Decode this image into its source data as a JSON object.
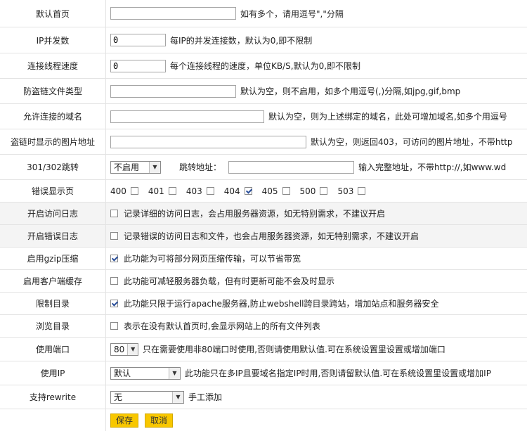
{
  "rows": {
    "default_page": {
      "label": "默认首页",
      "value": "",
      "hint": "如有多个，请用逗号\",\"分隔"
    },
    "ip_concurrency": {
      "label": "IP并发数",
      "value": "0",
      "hint": "每IP的并发连接数，默认为0,即不限制"
    },
    "thread_speed": {
      "label": "连接线程速度",
      "value": "0",
      "hint": "每个连接线程的速度，单位KB/S,默认为0,即不限制"
    },
    "hotlink_types": {
      "label": "防盗链文件类型",
      "value": "",
      "hint": "默认为空，则不启用，如多个用逗号(,)分隔,如jpg,gif,bmp"
    },
    "allowed_domains": {
      "label": "允许连接的域名",
      "value": "",
      "hint": "默认为空，则为上述绑定的域名，此处可增加域名,如多个用逗号"
    },
    "hotlink_image": {
      "label": "盗链时显示的图片地址",
      "value": "",
      "hint": "默认为空，则返回403，可访问的图片地址，不带http"
    },
    "redirect": {
      "label": "301/302跳转",
      "select_value": "不启用",
      "addr_label": "跳转地址：",
      "value": "",
      "hint": "输入完整地址，不带http://,如www.wd"
    },
    "error_pages": {
      "label": "错误显示页",
      "codes": [
        {
          "code": "400",
          "checked": false
        },
        {
          "code": "401",
          "checked": false
        },
        {
          "code": "403",
          "checked": false
        },
        {
          "code": "404",
          "checked": true
        },
        {
          "code": "405",
          "checked": false
        },
        {
          "code": "500",
          "checked": false
        },
        {
          "code": "503",
          "checked": false
        }
      ]
    },
    "access_log": {
      "label": "开启访问日志",
      "checked": false,
      "desc": "记录详细的访问日志，会占用服务器资源，如无特别需求，不建议开启"
    },
    "error_log": {
      "label": "开启错误日志",
      "checked": false,
      "desc": "记录错误的访问日志和文件，也会占用服务器资源，如无特别需求，不建议开启"
    },
    "gzip": {
      "label": "启用gzip压缩",
      "checked": true,
      "desc": "此功能为可将部分网页压缩传输，可以节省带宽"
    },
    "client_cache": {
      "label": "启用客户端缓存",
      "checked": false,
      "desc": "此功能可减轻服务器负载，但有时更新可能不会及时显示"
    },
    "restrict_dir": {
      "label": "限制目录",
      "checked": true,
      "desc": "此功能只限于运行apache服务器,防止webshell跨目录跨站，增加站点和服务器安全"
    },
    "browse_dir": {
      "label": "浏览目录",
      "checked": false,
      "desc": "表示在没有默认首页时,会显示网站上的所有文件列表"
    },
    "port": {
      "label": "使用端口",
      "select_value": "80",
      "hint": "只在需要使用非80端口时使用,否则请使用默认值.可在系统设置里设置或增加端口"
    },
    "use_ip": {
      "label": "使用IP",
      "select_value": "默认",
      "hint": "此功能只在多IP且要域名指定IP时用,否则请留默认值.可在系统设置里设置或增加IP"
    },
    "rewrite": {
      "label": "支持rewrite",
      "select_value": "无",
      "hint": "手工添加"
    }
  },
  "buttons": {
    "save": "保存",
    "cancel": "取消"
  },
  "colors": {
    "button_bg": "#f8c700",
    "shaded_row": "#f4f4f4",
    "border": "#e3e3e3"
  }
}
